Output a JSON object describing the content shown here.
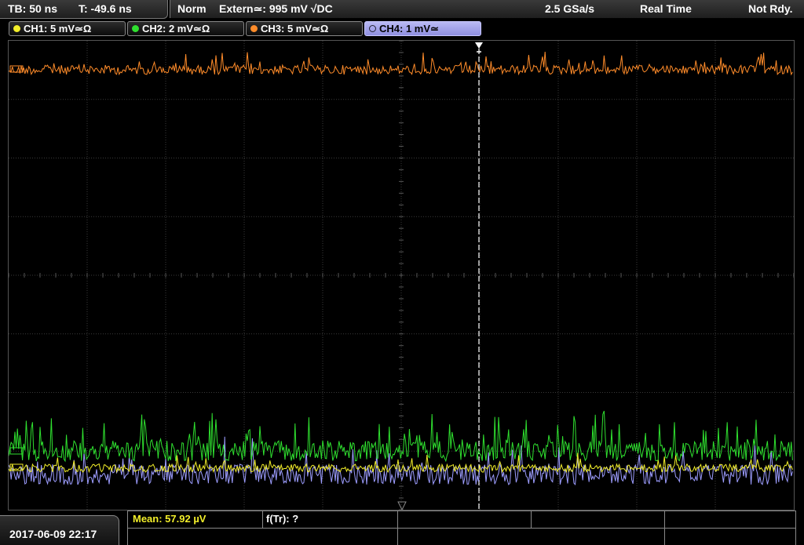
{
  "timebase": {
    "tb": "TB: 50 ns",
    "trig_pos": "T: -49.6 ns"
  },
  "status": {
    "mode": "Norm",
    "trigger": "Extern≃: 995 mV √DC",
    "sample_rate": "2.5 GSa/s",
    "acq_mode": "Real Time",
    "state": "Not Rdy."
  },
  "channels": [
    {
      "label": "CH1: 5 mV≃Ω",
      "color": "#f2ee2a"
    },
    {
      "label": "CH2: 2 mV≃Ω",
      "color": "#2fe02f"
    },
    {
      "label": "CH3: 5 mV≃Ω",
      "color": "#ff8c2a"
    },
    {
      "label": "CH4: 1 mV≃",
      "color": "#9d9dff",
      "active": true
    }
  ],
  "footer": {
    "date": "2017-06-09 22:17",
    "measurement_1": "Mean: 57.92 µV",
    "measurement_2": "f(Tr): ?"
  },
  "grid_color": "#3a3a3a",
  "cursor_icon": "trigger-marker-icon"
}
